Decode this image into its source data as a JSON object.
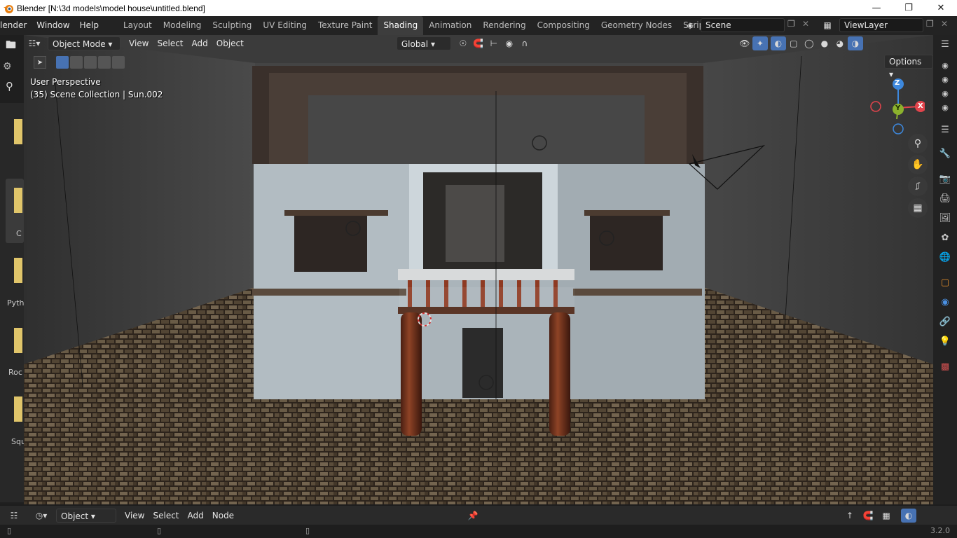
{
  "window": {
    "title": "Blender [N:\\3d models\\model house\\untitled.blend]",
    "minimize": "—",
    "restore": "❐",
    "close": "✕"
  },
  "menu": {
    "items": [
      "lender",
      "Window",
      "Help"
    ]
  },
  "workspaces": {
    "tabs": [
      "Layout",
      "Modeling",
      "Sculpting",
      "UV Editing",
      "Texture Paint",
      "Shading",
      "Animation",
      "Rendering",
      "Compositing",
      "Geometry Nodes",
      "Scripting"
    ],
    "active": "Shading",
    "add": "+"
  },
  "scene": {
    "name": "Scene",
    "view_layer": "ViewLayer"
  },
  "viewport_header": {
    "mode": "Object Mode",
    "menus": [
      "View",
      "Select",
      "Add",
      "Object"
    ],
    "transform": "Global",
    "options": "Options"
  },
  "overlay": {
    "perspective": "User Perspective",
    "collection": "(35) Scene Collection | Sun.002"
  },
  "gizmo": {
    "z": "Z",
    "x": "X",
    "y": "Y"
  },
  "left_panel": {
    "labels": [
      "C",
      "Pyth",
      "Roc",
      "Squ"
    ]
  },
  "bottom_editor": {
    "mode": "Object",
    "menus": [
      "View",
      "Select",
      "Add",
      "Node"
    ]
  },
  "status": {
    "version": "3.2.0"
  },
  "colors": {
    "accent_blue": "#4772b3",
    "gizmo_x": "#e2444c",
    "gizmo_y": "#8cb22d",
    "gizmo_z": "#3d88dd"
  }
}
